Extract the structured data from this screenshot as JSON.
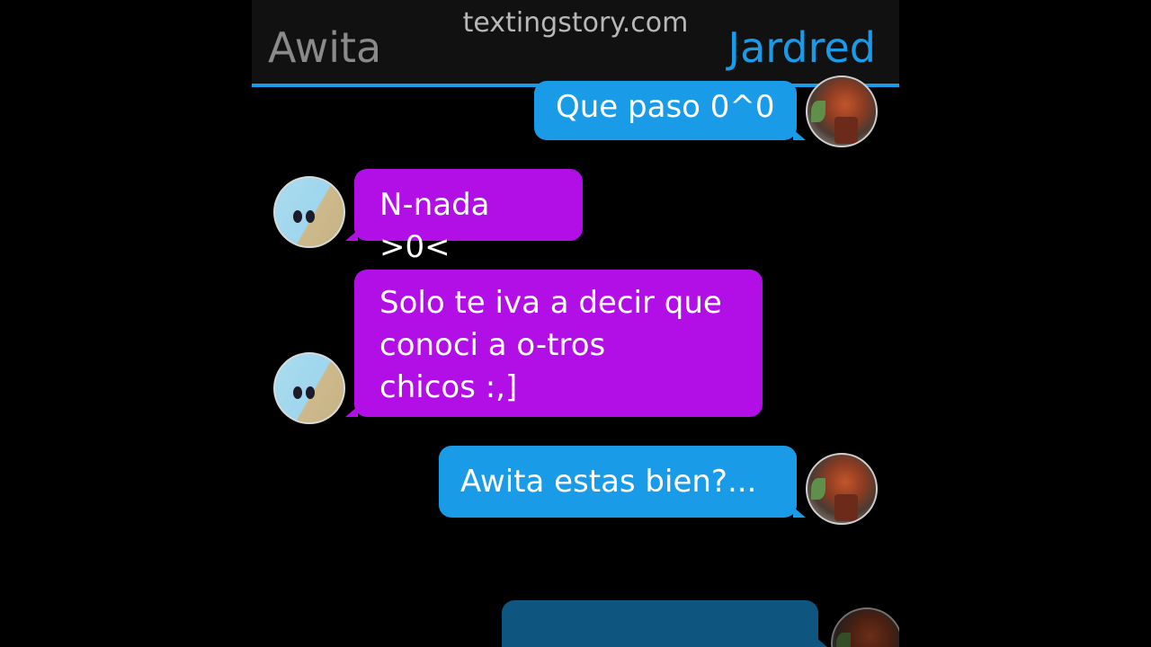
{
  "watermark": "textingstory.com",
  "header": {
    "left_name": "Awita",
    "right_name": "Jardred"
  },
  "messages": [
    {
      "sender": "Jardred",
      "text": "Que paso 0^0"
    },
    {
      "sender": "Awita",
      "text": "N-nada >0<"
    },
    {
      "sender": "Awita",
      "text": "Solo te iva a decir que\nconoci a o-tros\nchicos :,]"
    },
    {
      "sender": "Jardred",
      "text": "Awita estas bien?..."
    },
    {
      "sender": "Jardred",
      "text": ""
    }
  ],
  "colors": {
    "background": "#000000",
    "header_bg": "#111111",
    "accent_blue": "#1a9be8",
    "received_purple": "#b10fe6",
    "left_name_gray": "#8a8a8a"
  },
  "icons": {
    "awita_avatar": "awita-avatar-icon",
    "jardred_avatar": "jardred-avatar-icon"
  }
}
